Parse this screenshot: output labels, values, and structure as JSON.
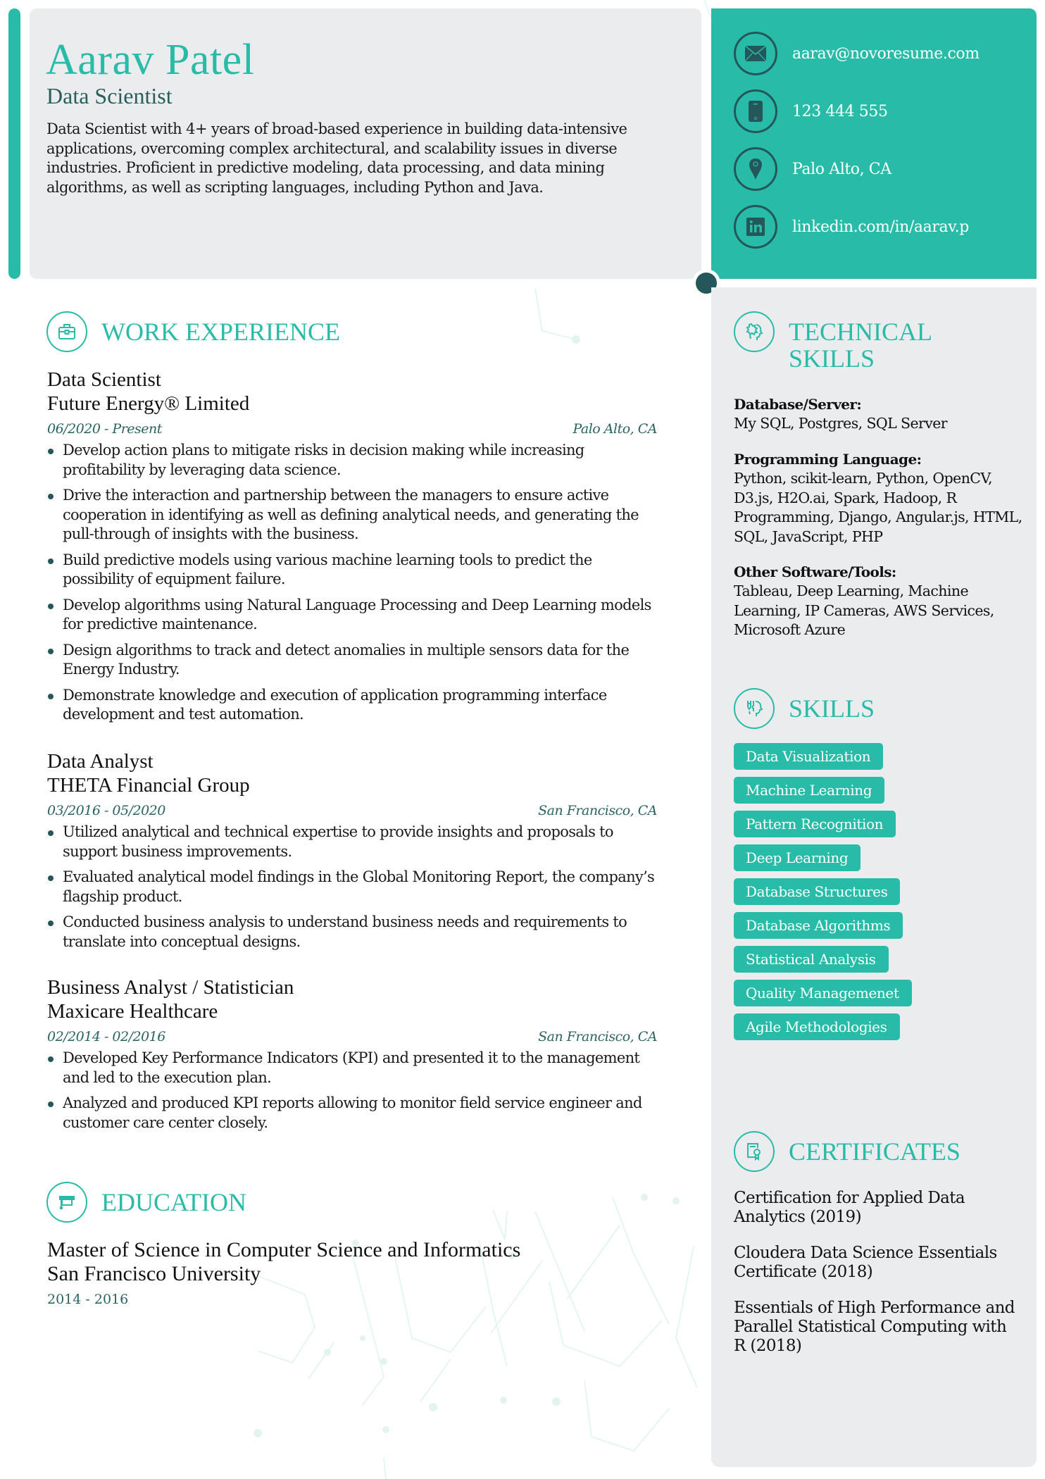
{
  "header": {
    "name": "Aarav Patel",
    "title": "Data Scientist",
    "summary": "Data Scientist with 4+ years of broad-based experience in building data-intensive applications, overcoming complex architectural, and scalability issues in diverse industries. Proficient in predictive modeling, data processing, and data mining algorithms, as well as scripting languages, including Python and Java."
  },
  "contact": [
    {
      "icon": "email-icon",
      "text": "aarav@novoresume.com"
    },
    {
      "icon": "phone-icon",
      "text": "123 444 555"
    },
    {
      "icon": "location-icon",
      "text": "Palo Alto, CA"
    },
    {
      "icon": "linkedin-icon",
      "text": "linkedin.com/in/aarav.p"
    }
  ],
  "sections": {
    "work_experience": "WORK EXPERIENCE",
    "education": "EDUCATION",
    "technical_skills_line1": "TECHNICAL",
    "technical_skills_line2": "SKILLS",
    "skills": "SKILLS",
    "certificates": "CERTIFICATES"
  },
  "jobs": [
    {
      "title": "Data Scientist",
      "company": "Future Energy® Limited",
      "dates": "06/2020 - Present",
      "location": "Palo Alto, CA",
      "bullets": [
        "Develop action plans to mitigate risks in decision making while increasing profitability by leveraging data science.",
        "Drive the interaction and partnership between the managers to ensure active cooperation in identifying as well as defining analytical needs, and generating the pull-through of insights with the business.",
        "Build predictive models using various machine learning tools to predict the possibility of equipment failure.",
        "Develop algorithms using Natural Language Processing and Deep Learning models for predictive maintenance.",
        "Design algorithms to track and detect anomalies in multiple sensors data for the Energy Industry.",
        "Demonstrate knowledge and execution of application programming interface development and test automation."
      ]
    },
    {
      "title": "Data Analyst",
      "company": "THETA Financial Group",
      "dates": "03/2016 - 05/2020",
      "location": "San Francisco, CA",
      "bullets": [
        "Utilized analytical and technical expertise to provide insights and proposals to support business improvements.",
        "Evaluated analytical model findings in the Global Monitoring Report, the company’s flagship product.",
        "Conducted business analysis to understand business needs and requirements to translate into conceptual designs."
      ]
    },
    {
      "title": "Business Analyst / Statistician",
      "company": "Maxicare Healthcare",
      "dates": "02/2014 - 02/2016",
      "location": "San Francisco, CA",
      "bullets": [
        "Developed Key Performance Indicators (KPI) and presented it to the management and led to the execution plan.",
        "Analyzed and produced KPI reports allowing to monitor field service engineer and customer care center closely."
      ]
    }
  ],
  "education": {
    "degree": "Master of Science in Computer Science and Informatics",
    "school": "San Francisco University",
    "dates": "2014 - 2016"
  },
  "technical_skills": [
    {
      "label": "Database/Server:",
      "value": "My SQL, Postgres, SQL Server"
    },
    {
      "label": "Programming Language:",
      "value": "Python, scikit-learn, Python, OpenCV, D3.js, H2O.ai, Spark, Hadoop, R Programming, Django, Angular.js, HTML, SQL, JavaScript, PHP"
    },
    {
      "label": "Other Software/Tools:",
      "value": "Tableau, Deep Learning, Machine Learning, IP Cameras, AWS Services, Microsoft Azure"
    }
  ],
  "skills": [
    "Data Visualization",
    "Machine Learning",
    "Pattern Recognition",
    "Deep Learning",
    "Database Structures",
    "Database Algorithms",
    "Statistical Analysis",
    "Quality Managemenet",
    "Agile Methodologies"
  ],
  "certificates": [
    "Certification for Applied Data Analytics (2019)",
    "Cloudera Data Science Essentials Certificate (2018)",
    "Essentials of High Performance and Parallel Statistical Computing with R (2018)"
  ],
  "colors": {
    "accent": "#28bca8",
    "dark": "#24565a",
    "panel": "#ebecee"
  }
}
